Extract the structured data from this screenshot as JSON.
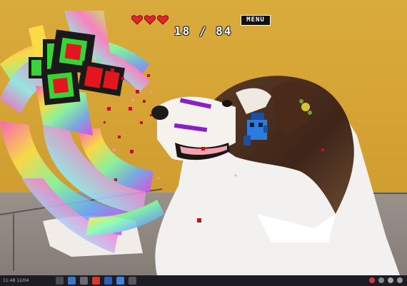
{
  "hud": {
    "lives": 3,
    "score_text": "18 / 84",
    "menu_label": "MENU"
  },
  "taskbar": {
    "status_text": "11:48 12/04"
  },
  "colors": {
    "heart": "#e8232c",
    "boss_dark": "#1a1a1a",
    "boss_green": "#37d337",
    "boss_red": "#e3161e",
    "player_blue": "#2b7be0",
    "laser": "#8a1ec8",
    "debris": "#c0131c",
    "taskbar": "#1c1c22"
  },
  "icons": {
    "lives": "heart-icon",
    "player": "robot-ship-icon",
    "boss": "block-boss-icon"
  }
}
